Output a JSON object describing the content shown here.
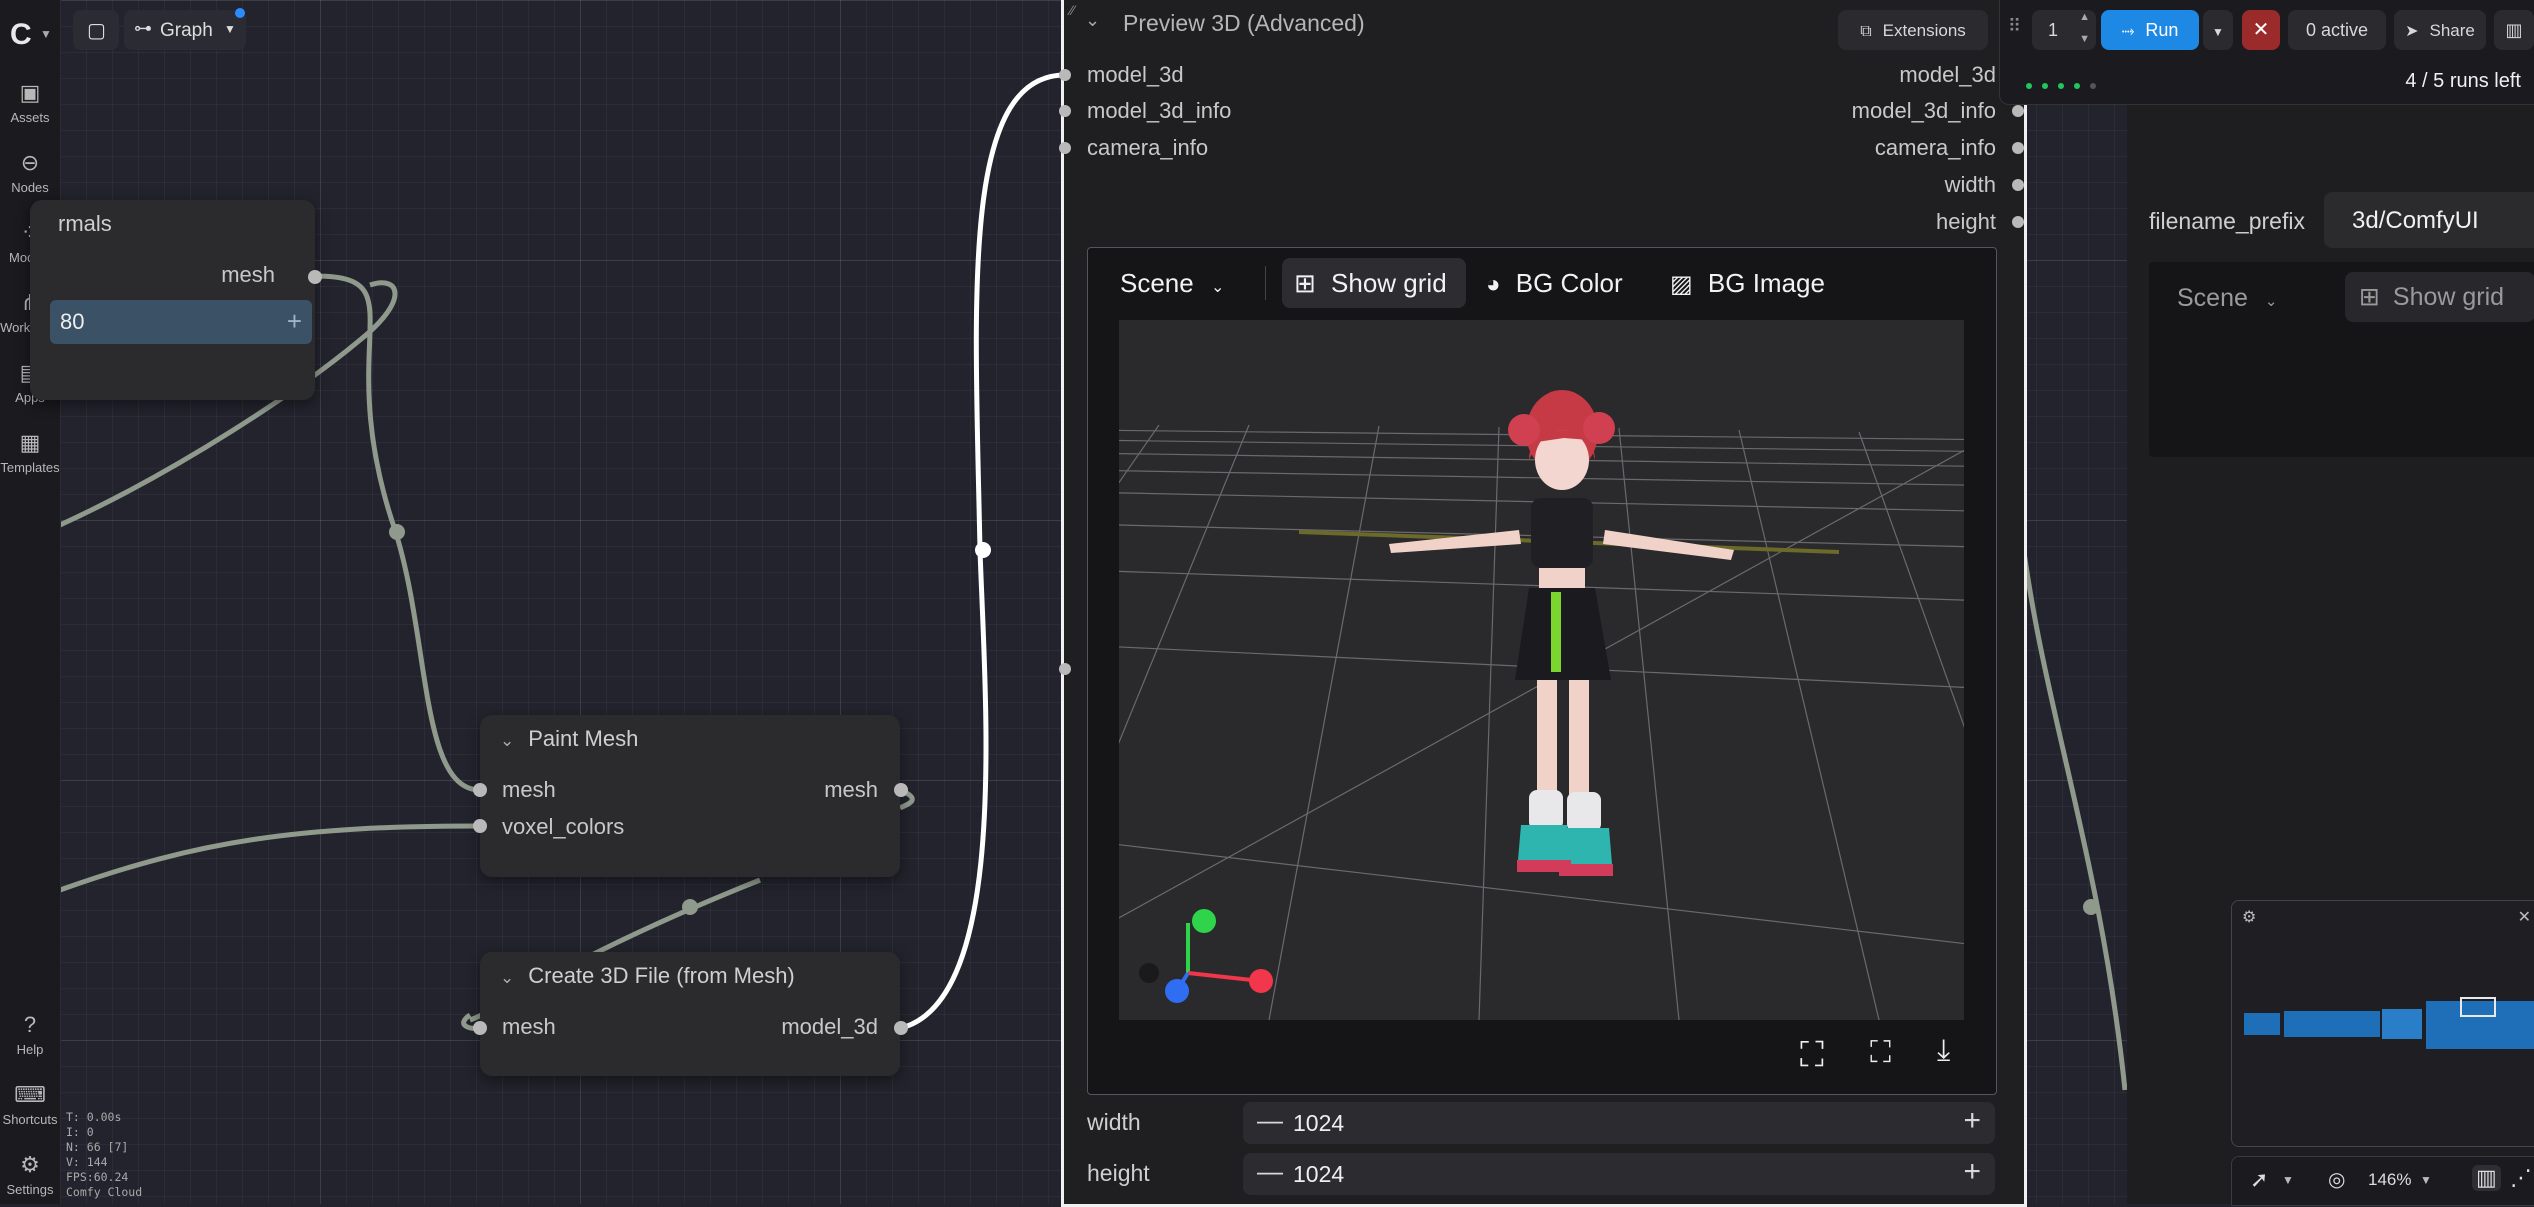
{
  "topbar_left": {
    "graph_label": "Graph"
  },
  "sidebar": {
    "items": [
      {
        "label": "Assets",
        "icon": "assets-icon"
      },
      {
        "label": "Nodes",
        "icon": "nodes-icon"
      },
      {
        "label": "Models",
        "icon": "models-icon"
      },
      {
        "label": "Workflows",
        "icon": "workflows-icon"
      },
      {
        "label": "Apps",
        "icon": "apps-icon"
      },
      {
        "label": "Templates",
        "icon": "templates-icon"
      }
    ],
    "help_label": "Help",
    "shortcuts_label": "Shortcuts",
    "settings_label": "Settings"
  },
  "stats": {
    "t": "T: 0.00s",
    "i": "I: 0",
    "n": "N: 66 [7]",
    "v": "V: 144",
    "fps": "FPS:60.24",
    "brand": "Comfy Cloud"
  },
  "nodes": {
    "normals": {
      "title_fragment": "rmals",
      "output": "mesh",
      "value": "80"
    },
    "paint_mesh": {
      "title": "Paint Mesh",
      "input1": "mesh",
      "input2": "voxel_colors",
      "output": "mesh"
    },
    "create3d": {
      "title": "Create 3D File (from Mesh)",
      "input": "mesh",
      "output": "model_3d"
    },
    "preview": {
      "title": "Preview 3D (Advanced)",
      "inputs": [
        "model_3d",
        "model_3d_info",
        "camera_info"
      ],
      "outputs": [
        "model_3d",
        "model_3d_info",
        "camera_info",
        "width",
        "height"
      ],
      "viewer": {
        "scene_label": "Scene",
        "show_grid": "Show grid",
        "bg_color": "BG Color",
        "bg_image": "BG Image"
      },
      "width_label": "width",
      "width_value": "1024",
      "height_label": "height",
      "height_value": "1024"
    }
  },
  "toolbar": {
    "extensions": "Extensions",
    "queue_count": "1",
    "run": "Run",
    "active": "0 active",
    "share": "Share",
    "runs_left": "4 / 5 runs left"
  },
  "right_panel": {
    "filename_label": "filename_prefix",
    "filename_value": "3d/ComfyUI",
    "scene_label": "Scene",
    "show_grid": "Show grid"
  },
  "bottom_tools": {
    "zoom": "146%"
  },
  "colors": {
    "accent": "#2c8cff",
    "run": "#1e88e5",
    "stop": "#9b2b2b",
    "progress": "#22c55e"
  }
}
